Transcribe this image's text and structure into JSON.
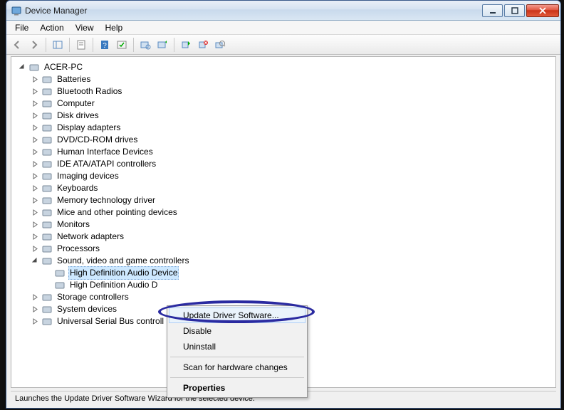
{
  "window": {
    "title": "Device Manager"
  },
  "menubar": {
    "items": [
      "File",
      "Action",
      "View",
      "Help"
    ]
  },
  "tree": {
    "root": "ACER-PC",
    "categories": [
      "Batteries",
      "Bluetooth Radios",
      "Computer",
      "Disk drives",
      "Display adapters",
      "DVD/CD-ROM drives",
      "Human Interface Devices",
      "IDE ATA/ATAPI controllers",
      "Imaging devices",
      "Keyboards",
      "Memory technology driver",
      "Mice and other pointing devices",
      "Monitors",
      "Network adapters",
      "Processors"
    ],
    "expanded_category": "Sound, video and game controllers",
    "expanded_children": [
      "High Definition Audio Device",
      "High Definition Audio D"
    ],
    "tail_categories": [
      "Storage controllers",
      "System devices",
      "Universal Serial Bus controll"
    ]
  },
  "context_menu": {
    "items": [
      {
        "label": "Update Driver Software...",
        "highlight": true
      },
      {
        "label": "Disable"
      },
      {
        "label": "Uninstall"
      },
      {
        "sep": true
      },
      {
        "label": "Scan for hardware changes"
      },
      {
        "sep": true
      },
      {
        "label": "Properties",
        "bold": true
      }
    ]
  },
  "statusbar": {
    "text": "Launches the Update Driver Software Wizard for the selected device."
  }
}
